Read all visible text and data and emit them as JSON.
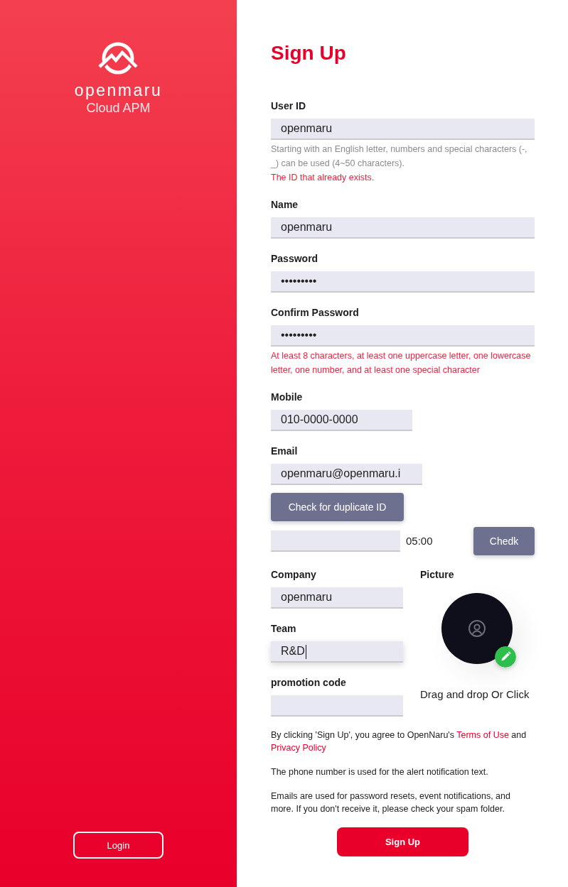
{
  "brand": {
    "wordmark": "openmaru",
    "product": "Cloud APM"
  },
  "login_button": "Login",
  "form": {
    "title": "Sign Up",
    "fields": [
      {
        "kind": "text",
        "label": "User ID",
        "value": "openmaru",
        "messages": [
          {
            "kind": "hint",
            "text": "Starting with an English letter, numbers and special characters (-, _) can be used (4~50 characters)."
          },
          {
            "kind": "error",
            "text": "The ID that already exists."
          }
        ]
      },
      {
        "kind": "text",
        "label": "Name",
        "value": "openmaru"
      },
      {
        "kind": "password",
        "label": "Password",
        "value": "•••••••••"
      },
      {
        "kind": "password",
        "label": "Confirm Password",
        "value": "•••••••••",
        "messages": [
          {
            "kind": "error",
            "text": "At least 8 characters, at least one uppercase letter, one lowercase letter, one number, and at least one special character"
          }
        ]
      },
      {
        "kind": "tel",
        "label": "Mobile",
        "value": "010-0000-0000"
      },
      {
        "kind": "email",
        "label": "Email",
        "value": "openmaru@openmaru.i"
      }
    ],
    "duplicate_check_button": "Check for duplicate ID",
    "verification": {
      "timer": "05:00",
      "button": "Chedk"
    },
    "extra_fields": [
      {
        "label": "Company",
        "value": "openmaru",
        "focused": false
      },
      {
        "label": "Team",
        "value": "R&D",
        "focused": true
      },
      {
        "label": "promotion code",
        "focused": false
      }
    ],
    "picture": {
      "label": "Picture",
      "hint": "Drag and drop Or Click"
    },
    "notes": [
      {
        "parts": [
          {
            "kind": "text",
            "text": "By clicking 'Sign Up', you agree to OpenNaru's "
          },
          {
            "kind": "link",
            "text": "Terms of Use"
          },
          {
            "kind": "text",
            "text": " and "
          },
          {
            "kind": "link",
            "text": "Privacy Policy"
          }
        ]
      },
      {
        "parts": [
          {
            "kind": "text",
            "text": "The phone number is used for the alert notification text."
          }
        ]
      },
      {
        "parts": [
          {
            "kind": "text",
            "text": "Emails are used for password resets, event notifications, and more. If you don't receive it, please check your spam folder."
          }
        ]
      }
    ],
    "submit_button": "Sign Up"
  }
}
